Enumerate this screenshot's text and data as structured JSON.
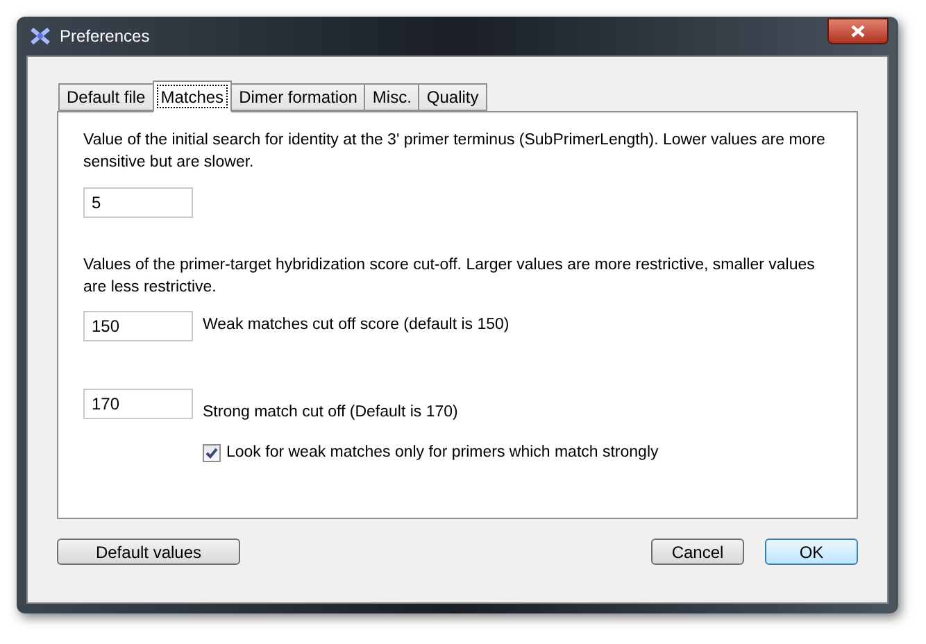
{
  "window": {
    "title": "Preferences"
  },
  "tabs": [
    {
      "label": "Default file",
      "selected": false
    },
    {
      "label": "Matches",
      "selected": true
    },
    {
      "label": "Dimer formation",
      "selected": false
    },
    {
      "label": "Misc.",
      "selected": false
    },
    {
      "label": "Quality",
      "selected": false
    }
  ],
  "panel": {
    "intro": "Value of the initial search for identity at the 3' primer terminus (SubPrimerLength).  Lower values are more sensitive but are slower.",
    "sub_primer_length": "5",
    "score_intro": "Values of the primer-target hybridization score cut-off.  Larger values are more restrictive, smaller values are less restrictive.",
    "weak": {
      "value": "150",
      "label": "Weak matches cut off score (default is 150)"
    },
    "strong": {
      "value": "170",
      "label": "Strong match cut off (Default is 170)"
    },
    "checkbox": {
      "label": "Look for weak matches only for primers which match strongly",
      "checked": true
    }
  },
  "buttons": {
    "defaults": "Default values",
    "cancel": "Cancel",
    "ok": "OK"
  }
}
